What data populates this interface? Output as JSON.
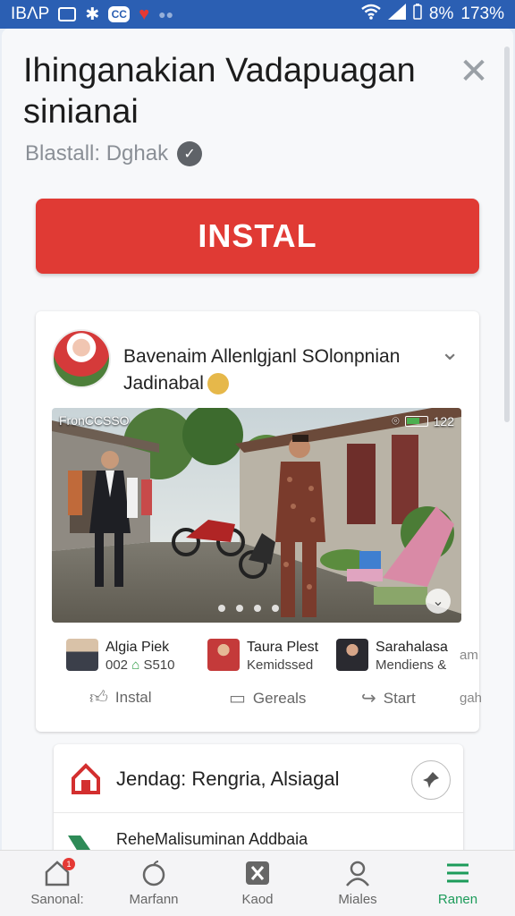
{
  "status_bar": {
    "left_text": "IBΛP",
    "battery": "8%",
    "right_text": "173%"
  },
  "header": {
    "title": "Ihinganakian Vadapuagan sinianai",
    "subtitle": "Blastall: Dghak",
    "verified_glyph": "✓",
    "close_glyph": "✕"
  },
  "install_button": {
    "label": "INSTAL"
  },
  "post": {
    "title": "Bavenaim Allenlgjanl SOlonpnian Jadinabal",
    "photo": {
      "overlay_label": "FronCCSSO",
      "overlay_count": "122",
      "carousel_dots": 4
    },
    "people": [
      {
        "name": "Algia Piek",
        "prefix": "002",
        "suffix": "S510"
      },
      {
        "name": "Taura Plest",
        "desc": "Kemidssed"
      },
      {
        "name": "Sarahalasa",
        "desc": "Mendiens &"
      }
    ],
    "actions": [
      {
        "label": "Instal",
        "icon": "thumbs-up-icon"
      },
      {
        "label": "Gereals",
        "icon": "comment-icon"
      },
      {
        "label": "Start",
        "icon": "share-icon"
      }
    ],
    "edge_texts": [
      "am",
      "gah"
    ]
  },
  "card2": {
    "title": "Jendag:  Rengria, Alsiagal",
    "sub_title": "RehеMalisuminan Addbaia"
  },
  "bottom_nav": {
    "items": [
      {
        "label": "Sanonal:",
        "icon": "home-icon",
        "badge": "1"
      },
      {
        "label": "Marfann",
        "icon": "apple-icon"
      },
      {
        "label": "Kaod",
        "icon": "tools-icon"
      },
      {
        "label": "Miales",
        "icon": "person-icon"
      },
      {
        "label": "Ranen",
        "icon": "menu-icon",
        "active": true
      }
    ]
  },
  "colors": {
    "status_bar": "#2b5fb3",
    "install": "#e03a34",
    "active_nav": "#1c9b5a"
  }
}
